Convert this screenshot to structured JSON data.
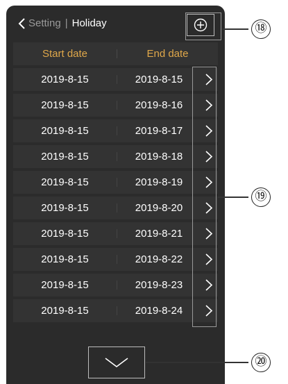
{
  "header": {
    "back_icon": "chevron-left-icon",
    "parent": "Setting",
    "separator": "|",
    "title": "Holiday",
    "add_icon": "plus-circle-icon"
  },
  "table": {
    "columns": [
      "Start date",
      "End date"
    ],
    "rows": [
      {
        "start": "2019-8-15",
        "end": "2019-8-15"
      },
      {
        "start": "2019-8-15",
        "end": "2019-8-16"
      },
      {
        "start": "2019-8-15",
        "end": "2019-8-17"
      },
      {
        "start": "2019-8-15",
        "end": "2019-8-18"
      },
      {
        "start": "2019-8-15",
        "end": "2019-8-19"
      },
      {
        "start": "2019-8-15",
        "end": "2019-8-20"
      },
      {
        "start": "2019-8-15",
        "end": "2019-8-21"
      },
      {
        "start": "2019-8-15",
        "end": "2019-8-22"
      },
      {
        "start": "2019-8-15",
        "end": "2019-8-23"
      },
      {
        "start": "2019-8-15",
        "end": "2019-8-24"
      }
    ],
    "row_action_icon": "chevron-right-icon"
  },
  "footer": {
    "more_icon": "chevron-down-icon"
  },
  "callouts": [
    "⑱",
    "⑲",
    "⑳"
  ],
  "colors": {
    "background": "#2b2b2b",
    "row": "#333333",
    "header_text": "#e0a84a",
    "text": "#ffffff",
    "muted": "#9a9a9a"
  }
}
